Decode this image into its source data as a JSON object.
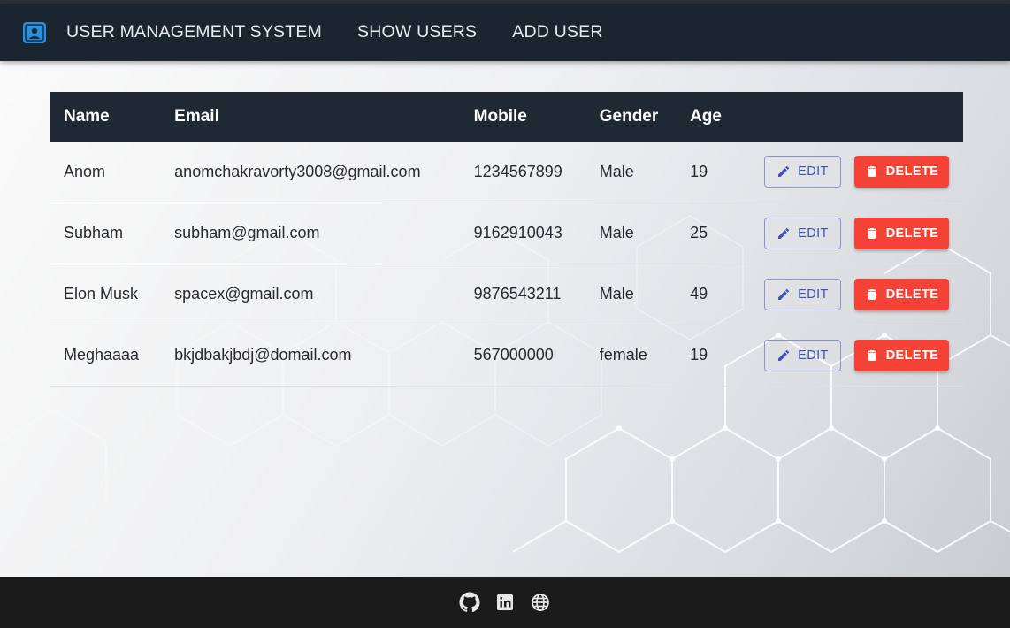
{
  "appbar": {
    "logo_icon": "account-box-icon",
    "title": "USER MANAGEMENT SYSTEM",
    "nav": [
      {
        "label": "SHOW USERS"
      },
      {
        "label": "ADD USER"
      }
    ],
    "background": "#1b2530"
  },
  "table": {
    "headers": {
      "name": "Name",
      "email": "Email",
      "mobile": "Mobile",
      "gender": "Gender",
      "age": "Age"
    },
    "rows": [
      {
        "name": "Anom",
        "email": "anomchakravorty3008@gmail.com",
        "mobile": "1234567899",
        "gender": "Male",
        "age": "19"
      },
      {
        "name": "Subham",
        "email": "subham@gmail.com",
        "mobile": "9162910043",
        "gender": "Male",
        "age": "25"
      },
      {
        "name": "Elon Musk",
        "email": "spacex@gmail.com",
        "mobile": "9876543211",
        "gender": "Male",
        "age": "49"
      },
      {
        "name": "Meghaaaa",
        "email": "bkjdbakjbdj@domail.com",
        "mobile": "567000000",
        "gender": "female",
        "age": "19"
      }
    ],
    "edit_label": "EDIT",
    "delete_label": "DELETE",
    "edit_icon": "pencil-icon",
    "delete_icon": "trash-icon"
  },
  "footer": {
    "icons": [
      "github-icon",
      "linkedin-icon",
      "globe-icon"
    ]
  },
  "colors": {
    "header_bg": "#1f2933",
    "edit": "#3f51b5",
    "delete": "#f44336",
    "footer_bg": "#1b1b1b"
  }
}
